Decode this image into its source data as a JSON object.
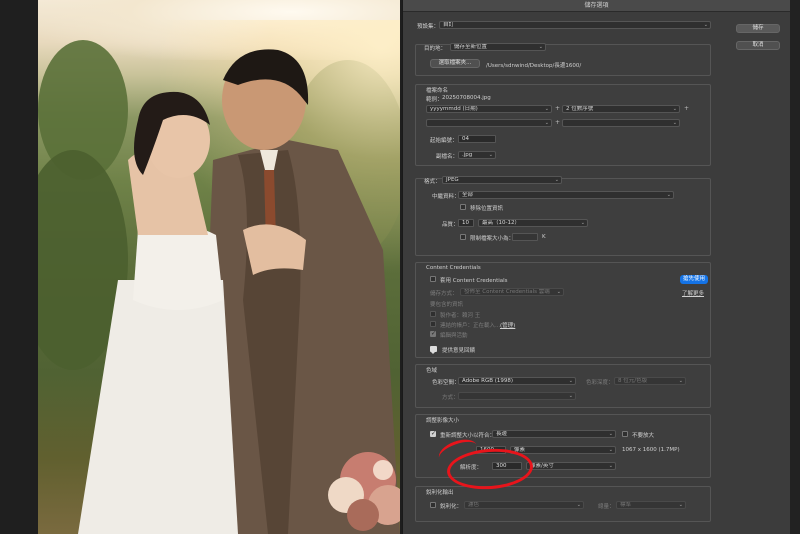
{
  "dialog": {
    "title": "儲存選項",
    "save_label": "儲存",
    "cancel_label": "取消"
  },
  "preset": {
    "label": "預設集：",
    "value": "自訂"
  },
  "destination": {
    "label": "目的地：",
    "value": "儲存至新位置",
    "choose_button": "選取檔案夾...",
    "path": "/Users/sdnwind/Desktop/長邊1600/"
  },
  "naming": {
    "title": "檔案命名",
    "example_label": "範例：",
    "example_value": "20250708004.jpg",
    "field1": "yyyymmdd (日期)",
    "field2": "2 位數序號",
    "field3": "",
    "field4": "",
    "start_label": "起始編號：",
    "start_value": "04",
    "ext_label": "副檔名：",
    "ext_value": ".jpg"
  },
  "format": {
    "title": "格式：",
    "value": "JPEG",
    "metadata_label": "中繼資料：",
    "metadata_value": "全部",
    "remove_location": "移除位置資訊",
    "quality_label": "品質：",
    "quality_value": "10",
    "quality_level": "最高（10-12）",
    "limit_size": "限制檔案大小為：",
    "limit_value": "",
    "limit_unit": "K"
  },
  "content_credentials": {
    "title": "Content Credentials",
    "apply": "套用 Content Credentials",
    "mode_label": "儲存方式：",
    "mode_value": "發佈至 Content Credentials 雲端",
    "include_label": "要包含的資訊",
    "producer": "製作者：賴河 王",
    "accounts": "連結的帳戶：正在載入...",
    "manage": "(管理)",
    "history": "編輯與活動",
    "early_access": "搶先使用",
    "learn_more": "了解更多",
    "feedback": "提供意見回饋"
  },
  "color_space": {
    "title": "色域",
    "label": "色彩空間：",
    "value": "Adobe RGB (1998)",
    "depth_label": "色彩深度：",
    "depth_value": "8 位元/色版",
    "intent_label": "方式：",
    "intent_value": ""
  },
  "resize": {
    "title": "調整影像大小",
    "resize_to_fit": "重新調整大小以符合：",
    "fit_value": "長邊",
    "dont_enlarge": "不要放大",
    "size_value": "1600",
    "size_unit": "像素",
    "dimensions": "1067 x 1600 (1.7MP)",
    "resolution_label": "解析度：",
    "resolution_value": "300",
    "resolution_unit": "像素/英寸"
  },
  "sharpen": {
    "title": "銳利化輸出",
    "label": "銳利化：",
    "value": "濾色",
    "amount_label": "總量：",
    "amount_value": "標準"
  },
  "colors": {
    "dialog_bg": "#3c3c3c",
    "accent_blue": "#1473e6",
    "annotation_red": "#e8141b"
  }
}
